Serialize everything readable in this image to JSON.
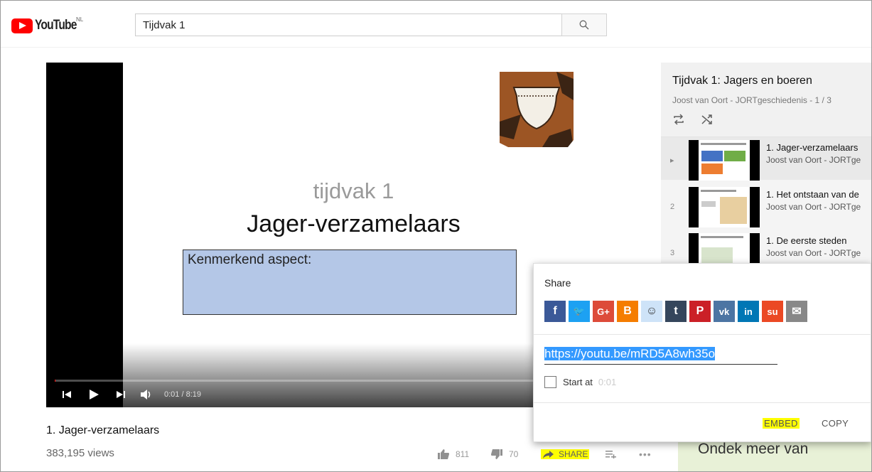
{
  "header": {
    "logo_text": "YouTube",
    "region": "NL",
    "search_value": "Tijdvak 1"
  },
  "video": {
    "slide_subtitle": "tijdvak 1",
    "slide_title": "Jager-verzamelaars",
    "slide_box_text": "Kenmerkend aspect:",
    "time": "0:01 / 8:19",
    "progress_fraction": 0.002
  },
  "below": {
    "title": "1. Jager-verzamelaars",
    "views": "383,195 views",
    "likes": "811",
    "dislikes": "70",
    "share_label": "SHARE"
  },
  "playlist": {
    "title": "Tijdvak 1: Jagers en boeren",
    "subtitle": "Joost van Oort - JORTgeschiedenis - 1 / 3",
    "items": [
      {
        "index": "▸",
        "title": "1. Jager-verzamelaars",
        "channel": "Joost van Oort - JORTge"
      },
      {
        "index": "2",
        "title": "1. Het ontstaan van de",
        "channel": "Joost van Oort - JORTge"
      },
      {
        "index": "3",
        "title": "1. De eerste steden",
        "channel": "Joost van Oort - JORTge"
      }
    ]
  },
  "share": {
    "heading": "Share",
    "url": "https://youtu.be/mRD5A8wh35o",
    "start_label": "Start at",
    "start_time": "0:01",
    "embed_label": "EMBED",
    "copy_label": "COPY",
    "networks": [
      {
        "name": "facebook-icon",
        "glyph": "f",
        "color": "#3b5998"
      },
      {
        "name": "twitter-icon",
        "glyph": "🐦",
        "color": "#1da1f2"
      },
      {
        "name": "google-plus-icon",
        "glyph": "G+",
        "color": "#dd4b39"
      },
      {
        "name": "blogger-icon",
        "glyph": "B",
        "color": "#f57d00"
      },
      {
        "name": "reddit-icon",
        "glyph": "☺",
        "color": "#cee3f8"
      },
      {
        "name": "tumblr-icon",
        "glyph": "t",
        "color": "#35465c"
      },
      {
        "name": "pinterest-icon",
        "glyph": "P",
        "color": "#cb2027"
      },
      {
        "name": "vk-icon",
        "glyph": "vk",
        "color": "#4c75a3"
      },
      {
        "name": "linkedin-icon",
        "glyph": "in",
        "color": "#0077b5"
      },
      {
        "name": "stumbleupon-icon",
        "glyph": "su",
        "color": "#eb4924"
      },
      {
        "name": "email-icon",
        "glyph": "✉",
        "color": "#888888"
      }
    ]
  },
  "ad": {
    "text": "Ondek meer van"
  }
}
